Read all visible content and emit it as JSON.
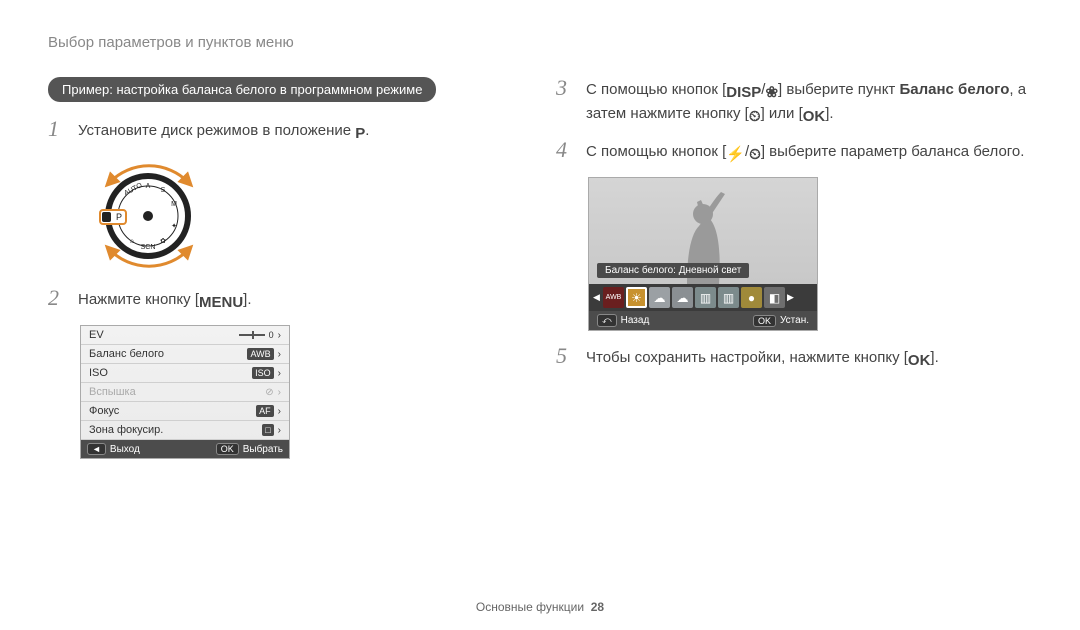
{
  "header": {
    "title": "Выбор параметров и пунктов меню"
  },
  "pill": {
    "text": "Пример: настройка баланса белого в программном режиме"
  },
  "steps": {
    "s1": {
      "num": "1",
      "text_before": "Установите диск режимов в положение ",
      "icon": "P",
      "text_after": "."
    },
    "s2": {
      "num": "2",
      "text_before": "Нажмите кнопку [",
      "icon": "MENU",
      "text_after": "]."
    },
    "s3": {
      "num": "3",
      "part_a": "С помощью кнопок [",
      "icon_disp": "DISP",
      "slash": "/",
      "icon_flower": "❀",
      "part_b": "] выберите пункт ",
      "bold": "Баланс белого",
      "part_c": ", а затем нажмите кнопку [",
      "icon_timer": "⏲",
      "part_d": "] или [",
      "icon_ok": "OK",
      "part_e": "]."
    },
    "s4": {
      "num": "4",
      "part_a": "С помощью кнопок [",
      "icon_flash": "⚡",
      "slash": "/",
      "icon_timer": "⏲",
      "part_b": "] выберите параметр баланса белого."
    },
    "s5": {
      "num": "5",
      "part_a": "Чтобы сохранить настройки, нажмите кнопку [",
      "icon_ok": "OK",
      "part_b": "]."
    }
  },
  "menu": {
    "rows": [
      {
        "label": "EV",
        "value_icon": "0",
        "badge": "",
        "arrow": "›"
      },
      {
        "label": "Баланс белого",
        "value_icon": "",
        "badge": "AWB",
        "arrow": "›"
      },
      {
        "label": "ISO",
        "value_icon": "",
        "badge": "ISO",
        "arrow": "›"
      },
      {
        "label": "Вспышка",
        "value_icon": "⊘",
        "badge": "",
        "arrow": "›",
        "disabled": true
      },
      {
        "label": "Фокус",
        "value_icon": "",
        "badge": "AF",
        "arrow": "›"
      },
      {
        "label": "Зона фокусир.",
        "value_icon": "",
        "badge": "□",
        "arrow": "›"
      }
    ],
    "footer": {
      "left_key": "◄",
      "left_label": "Выход",
      "right_key": "OK",
      "right_label": "Выбрать"
    }
  },
  "preview": {
    "label": "Баланс белого: Дневной свет",
    "chips": [
      {
        "bg": "#6a1f1f",
        "text": "AWB"
      },
      {
        "bg": "#c8922f",
        "glyph": "☀"
      },
      {
        "bg": "#9ba0a4",
        "glyph": "☁"
      },
      {
        "bg": "#8a8f93",
        "glyph": "☁"
      },
      {
        "bg": "#7c8b8c",
        "glyph": "▥"
      },
      {
        "bg": "#7c8b8c",
        "glyph": "▥"
      },
      {
        "bg": "#a08a3a",
        "glyph": "●"
      },
      {
        "bg": "#6e6e6e",
        "glyph": "◧"
      }
    ],
    "footer": {
      "left_key": "⤺",
      "left_label": "Назад",
      "right_key": "OK",
      "right_label": "Устан."
    }
  },
  "footer": {
    "section": "Основные функции",
    "page": "28"
  }
}
